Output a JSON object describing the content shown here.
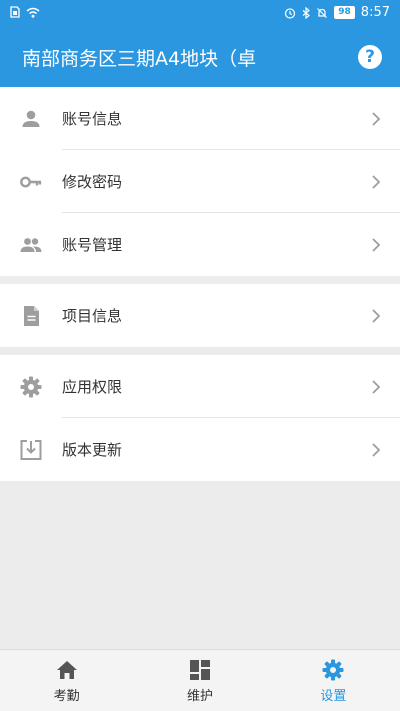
{
  "status_bar": {
    "battery": "98",
    "time": "8:57"
  },
  "header": {
    "title": "南部商务区三期A4地块（卓",
    "help_icon": "?"
  },
  "menu": {
    "group1": [
      {
        "label": "账号信息",
        "icon": "person-icon"
      },
      {
        "label": "修改密码",
        "icon": "key-icon"
      },
      {
        "label": "账号管理",
        "icon": "people-icon"
      }
    ],
    "group2": [
      {
        "label": "项目信息",
        "icon": "document-icon"
      }
    ],
    "group3": [
      {
        "label": "应用权限",
        "icon": "gear-icon"
      },
      {
        "label": "版本更新",
        "icon": "download-icon"
      }
    ]
  },
  "tabs": [
    {
      "label": "考勤",
      "icon": "home-icon",
      "active": false
    },
    {
      "label": "维护",
      "icon": "dashboard-icon",
      "active": false
    },
    {
      "label": "设置",
      "icon": "gear-icon",
      "active": true
    }
  ],
  "colors": {
    "primary": "#2b97e0",
    "icon_gray": "#9e9e9e",
    "background": "#ececec"
  }
}
